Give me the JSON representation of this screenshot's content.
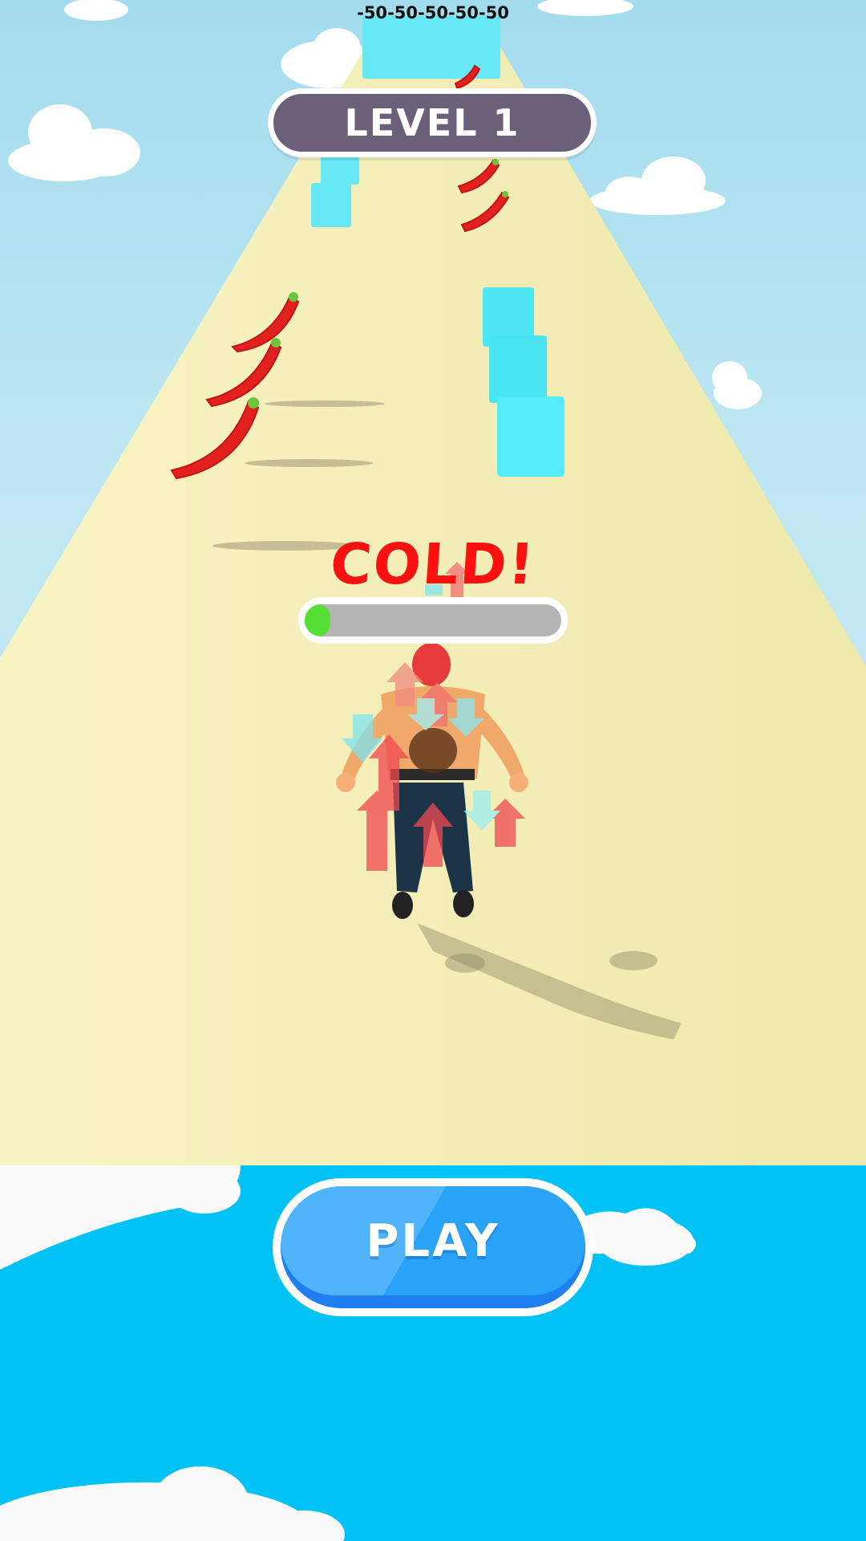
{
  "hud": {
    "score_popups": [
      "-50",
      "-50",
      "-50",
      "-50",
      "-50"
    ],
    "level_label": "LEVEL 1"
  },
  "status": {
    "temperature_text": "COLD!",
    "temperature_level": 0.1
  },
  "menu": {
    "play_label": "PLAY"
  },
  "colors": {
    "level_pill": "#6b5f79",
    "cold_text": "#ff1010",
    "meter_fill": "#55e035",
    "play_button": "#29a3f7",
    "bottom_panel": "#00c2f5"
  },
  "objects": {
    "left_lane": "chili-pepper-icon",
    "right_lane": "ice-cube-icon",
    "player": "muscle-runner-character"
  }
}
